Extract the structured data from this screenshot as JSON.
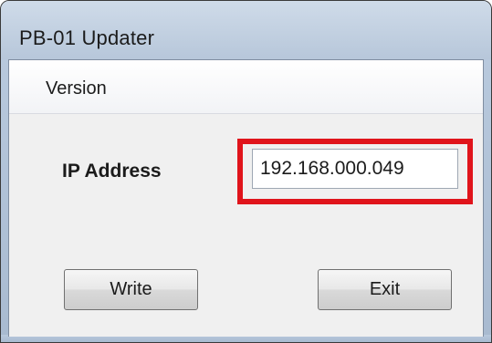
{
  "window": {
    "title": "PB-01 Updater"
  },
  "menu": {
    "items": [
      {
        "label": "Version"
      }
    ]
  },
  "form": {
    "ip_label": "IP Address",
    "ip_value": "192.168.000.049",
    "highlight_color": "#e0141b"
  },
  "buttons": {
    "write_label": "Write",
    "exit_label": "Exit"
  }
}
